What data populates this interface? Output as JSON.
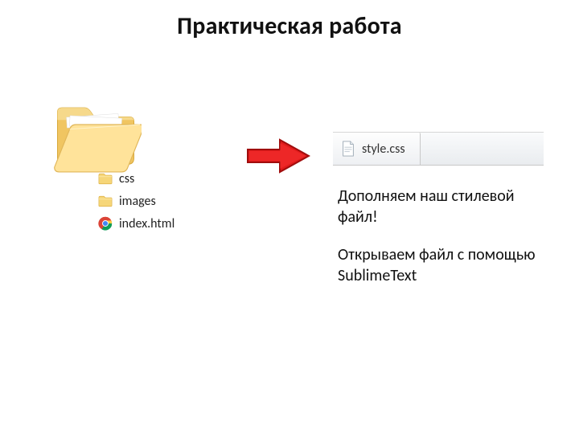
{
  "title": "Практическая работа",
  "folder": {
    "items": [
      {
        "name": "css",
        "type": "folder"
      },
      {
        "name": "images",
        "type": "folder"
      },
      {
        "name": "index.html",
        "type": "chrome"
      }
    ]
  },
  "tab": {
    "filename": "style.css"
  },
  "paragraph": {
    "line1": "Дополняем наш стилевой файл!",
    "line2": "Открываем файл с помощью SublimeText"
  },
  "icons": {
    "open_folder": "open-folder-icon",
    "small_folder": "small-folder-icon",
    "chrome": "chrome-icon",
    "arrow": "red-arrow-icon",
    "document": "document-icon"
  }
}
